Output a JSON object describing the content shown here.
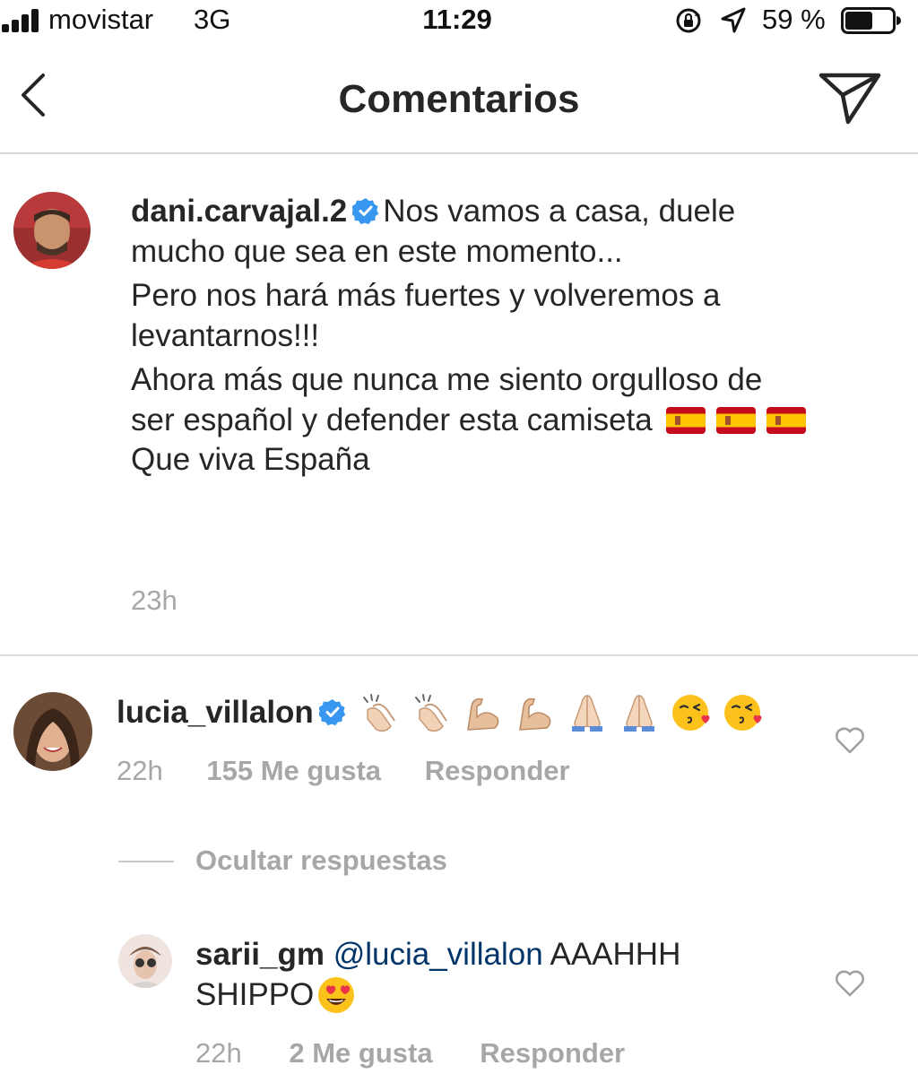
{
  "status_bar": {
    "carrier": "movistar",
    "network": "3G",
    "time": "11:29",
    "battery_percent": "59 %",
    "battery_level": 0.59,
    "icons": [
      "signal-icon",
      "rotation-lock-icon",
      "location-arrow-icon",
      "battery-icon"
    ]
  },
  "header": {
    "title": "Comentarios",
    "back_icon": "chevron-left-icon",
    "share_icon": "paper-plane-icon"
  },
  "caption": {
    "username": "dani.carvajal.2",
    "verified": true,
    "text_line1_prefix": "Nos vamos a casa,",
    "text_line1_rest": "duele mucho que sea en este momento...",
    "paragraph2": "Pero nos hará más fuertes y volveremos a levantarnos!!!",
    "paragraph3_prefix": "Ahora más que nunca me siento orgulloso de ser español y defender esta camiseta",
    "flags": [
      "spain-flag",
      "spain-flag",
      "spain-flag"
    ],
    "paragraph3_suffix": "Que viva España",
    "time": "23h"
  },
  "comments": [
    {
      "username": "lucia_villalon",
      "verified": true,
      "emojis": [
        "clapping-hands",
        "clapping-hands",
        "flexed-biceps",
        "flexed-biceps",
        "folded-hands",
        "folded-hands",
        "face-blowing-kiss",
        "face-blowing-kiss"
      ],
      "time": "22h",
      "likes": "155 Me gusta",
      "reply_label": "Responder",
      "hide_replies_label": "Ocultar respuestas",
      "replies": [
        {
          "username": "sarii_gm",
          "mention": "@lucia_villalon",
          "text_line1": "AAAHHH",
          "text_line2": "SHIPPO",
          "emoji": "heart-eyes",
          "time": "22h",
          "likes": "2 Me gusta",
          "reply_label": "Responder"
        }
      ]
    }
  ],
  "colors": {
    "text": "#262626",
    "secondary": "#a7a7a7",
    "verified_blue": "#3897f0",
    "mention": "#003569",
    "divider": "#dbdbdb"
  }
}
